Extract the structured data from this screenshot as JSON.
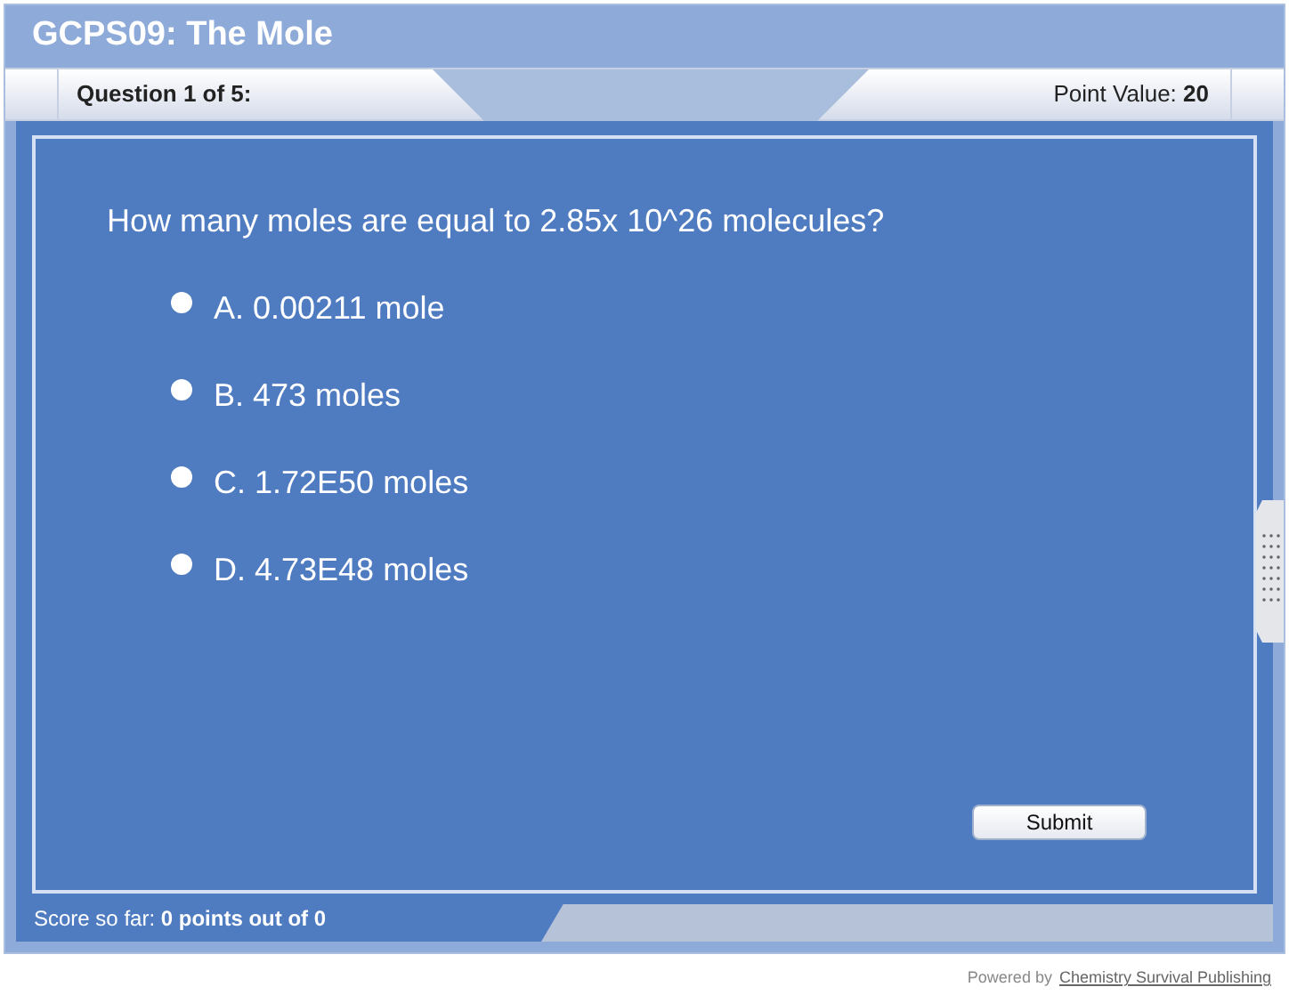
{
  "window": {
    "title": "GCPS09: The Mole"
  },
  "header": {
    "question_label": "Question 1 of 5:",
    "point_value_label": "Point Value:",
    "point_value": "20"
  },
  "question": {
    "text": "How many moles are equal to 2.85x 10^26 molecules?",
    "options": [
      {
        "label": "A. 0.00211 mole",
        "selected": false
      },
      {
        "label": "B. 473 moles",
        "selected": false
      },
      {
        "label": "C. 1.72E50 moles",
        "selected": false
      },
      {
        "label": "D. 4.73E48 moles",
        "selected": false
      }
    ]
  },
  "submit_button": "Submit",
  "score": {
    "label": "Score so far:",
    "value": "0 points out of 0"
  },
  "footer": {
    "powered_by": "Powered by",
    "link": "Chemistry Survival Publishing"
  }
}
